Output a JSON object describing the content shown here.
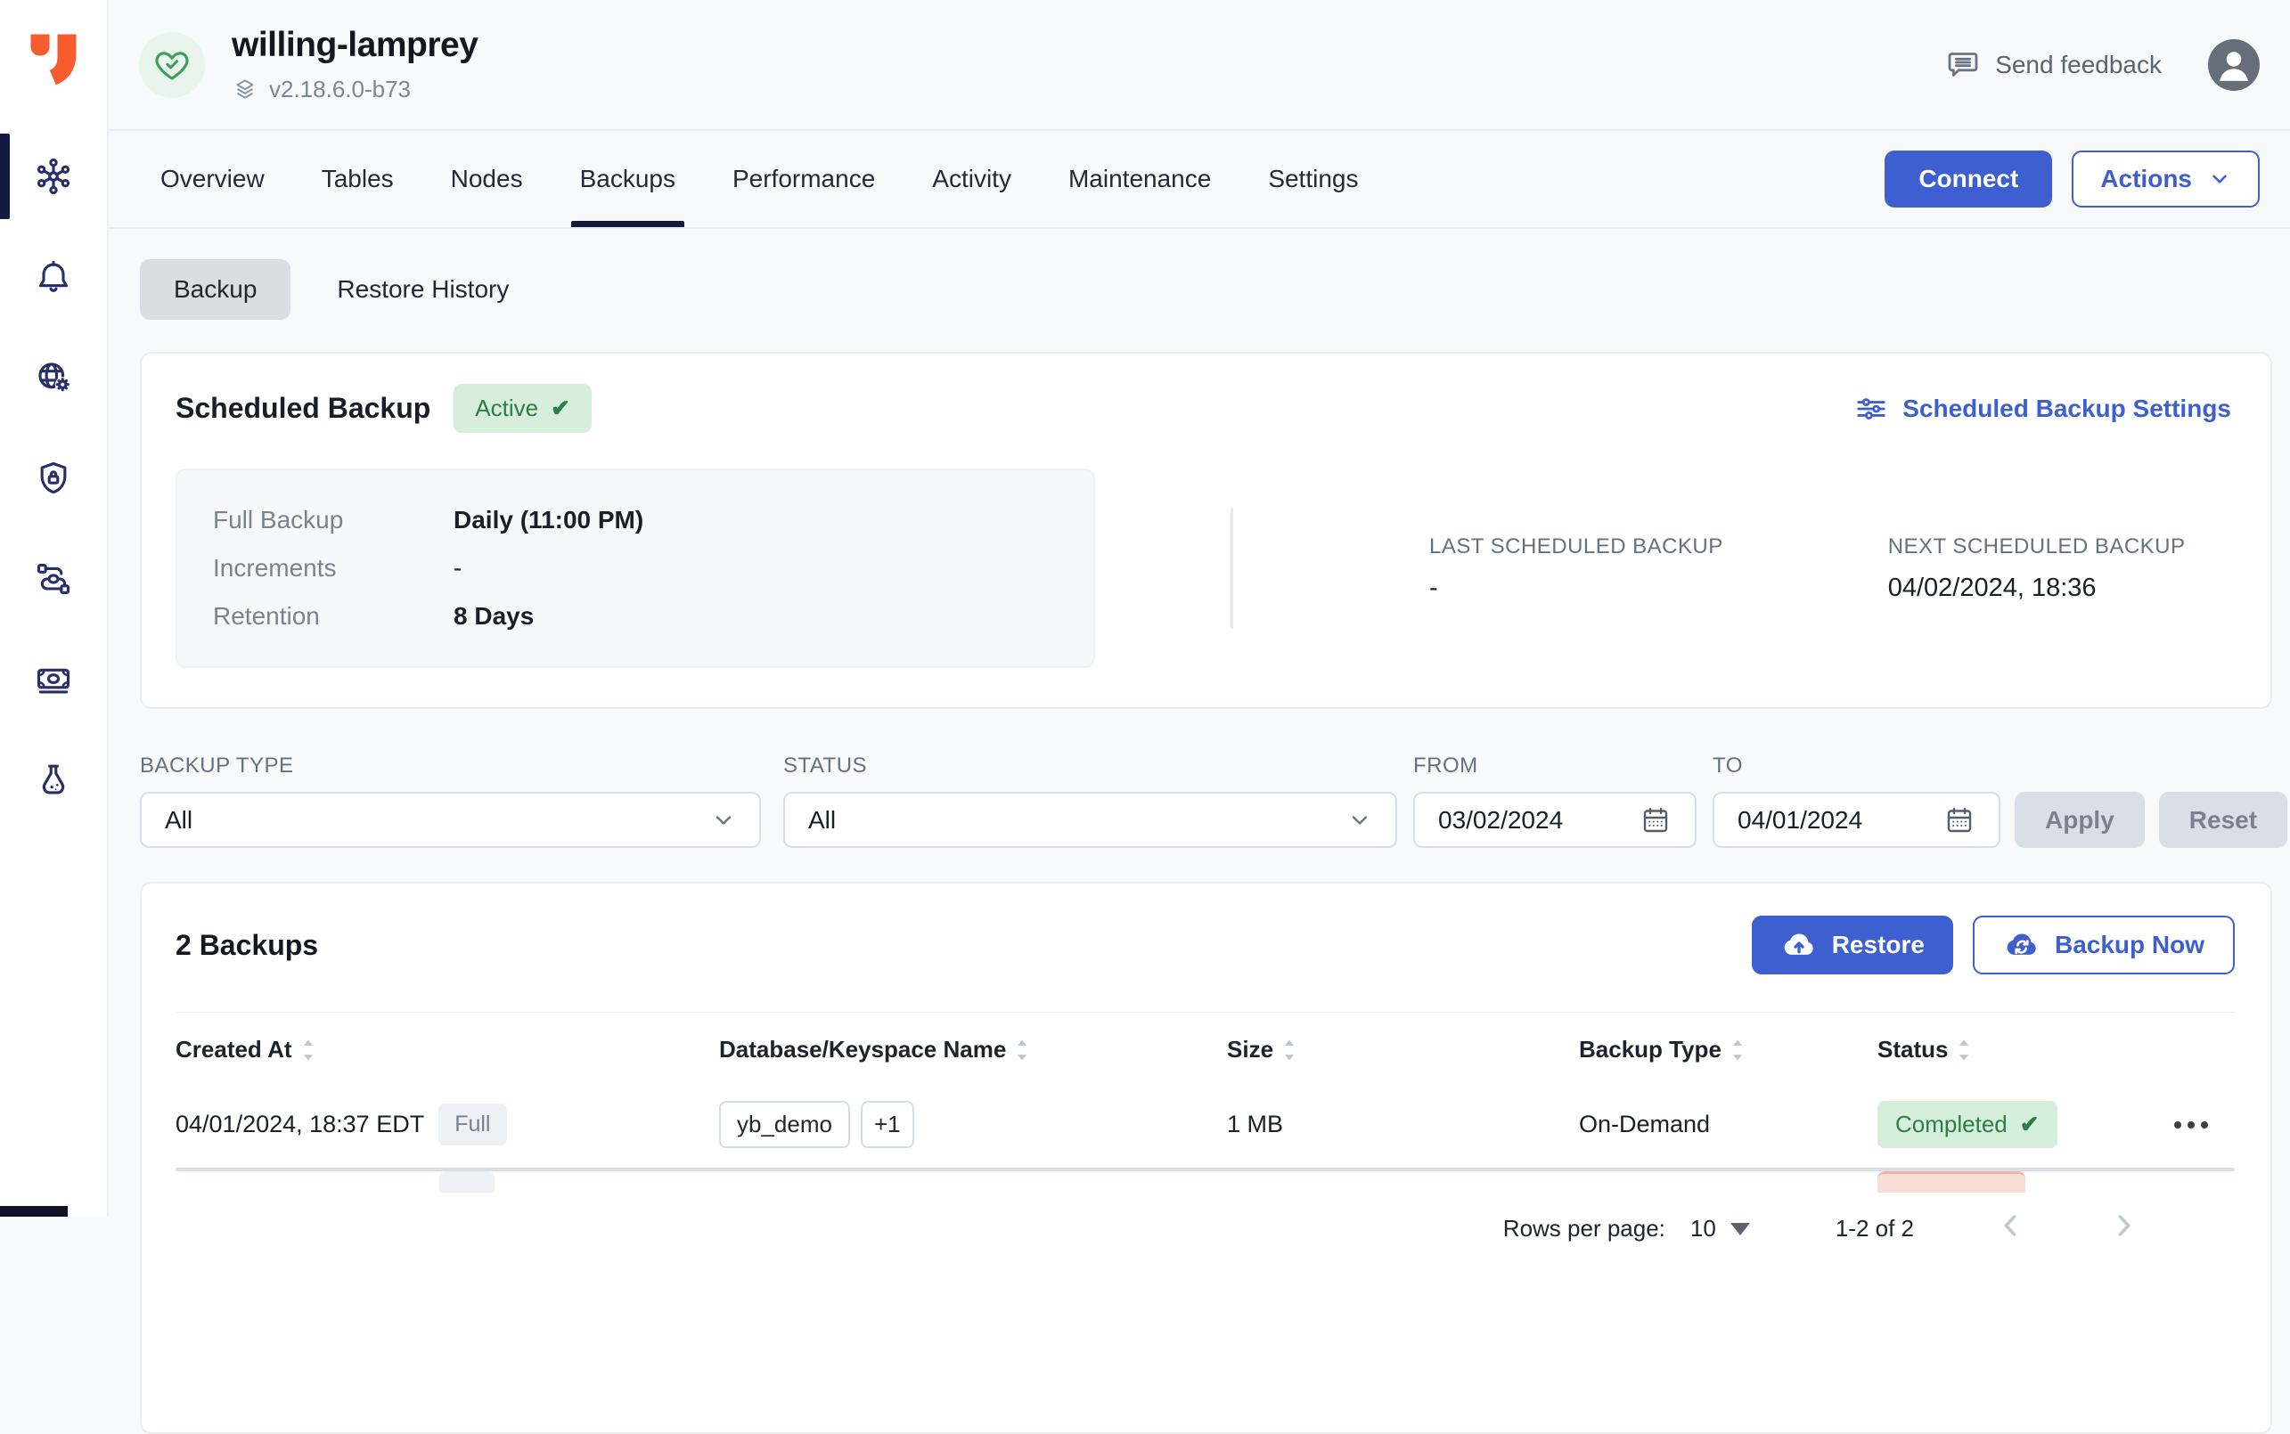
{
  "header": {
    "cluster_name": "willing-lamprey",
    "version": "v2.18.6.0-b73",
    "send_feedback": "Send feedback"
  },
  "sidebar": {
    "items": [
      "clusters",
      "alerts",
      "network",
      "security",
      "integrations",
      "billing",
      "labs"
    ],
    "active": "clusters"
  },
  "tabs": {
    "items": [
      "Overview",
      "Tables",
      "Nodes",
      "Backups",
      "Performance",
      "Activity",
      "Maintenance",
      "Settings"
    ],
    "active": "Backups"
  },
  "actions": {
    "connect": "Connect",
    "actions_menu": "Actions"
  },
  "subtabs": {
    "backup": "Backup",
    "restore_history": "Restore History"
  },
  "scheduled": {
    "title": "Scheduled Backup",
    "status_badge": "Active",
    "status_check": "✔",
    "settings_link": "Scheduled Backup Settings",
    "fields": [
      {
        "label": "Full Backup",
        "value": "Daily (11:00 PM)"
      },
      {
        "label": "Increments",
        "value": "-"
      },
      {
        "label": "Retention",
        "value": "8 Days"
      }
    ],
    "last_label": "LAST SCHEDULED BACKUP",
    "last_value": "-",
    "next_label": "NEXT SCHEDULED BACKUP",
    "next_value": "04/02/2024, 18:36"
  },
  "filters": {
    "backup_type_label": "BACKUP TYPE",
    "backup_type_value": "All",
    "status_label": "STATUS",
    "status_value": "All",
    "from_label": "FROM",
    "from_value": "03/02/2024",
    "to_label": "TO",
    "to_value": "04/01/2024",
    "apply": "Apply",
    "reset": "Reset"
  },
  "backups": {
    "count_title": "2 Backups",
    "restore": "Restore",
    "backup_now": "Backup Now",
    "columns": [
      "Created At",
      "Database/Keyspace Name",
      "Size",
      "Backup Type",
      "Status"
    ],
    "rows": [
      {
        "created_at": "04/01/2024, 18:37 EDT",
        "type_badge": "Full",
        "keyspace": "yb_demo",
        "keyspace_more": "+1",
        "size": "1 MB",
        "backup_type": "On-Demand",
        "status": "Completed",
        "status_check": "✔"
      }
    ]
  },
  "pagination": {
    "rows_per_page_label": "Rows per page:",
    "rows_per_page_value": "10",
    "range": "1-2 of 2"
  },
  "colors": {
    "accent_blue": "#3E5FD0",
    "navy": "#141A3F",
    "brand_orange": "#F75C2F",
    "success_green": "#2E7D44",
    "success_bg": "#D7EEDD",
    "page_bg": "#F7F9FB"
  }
}
